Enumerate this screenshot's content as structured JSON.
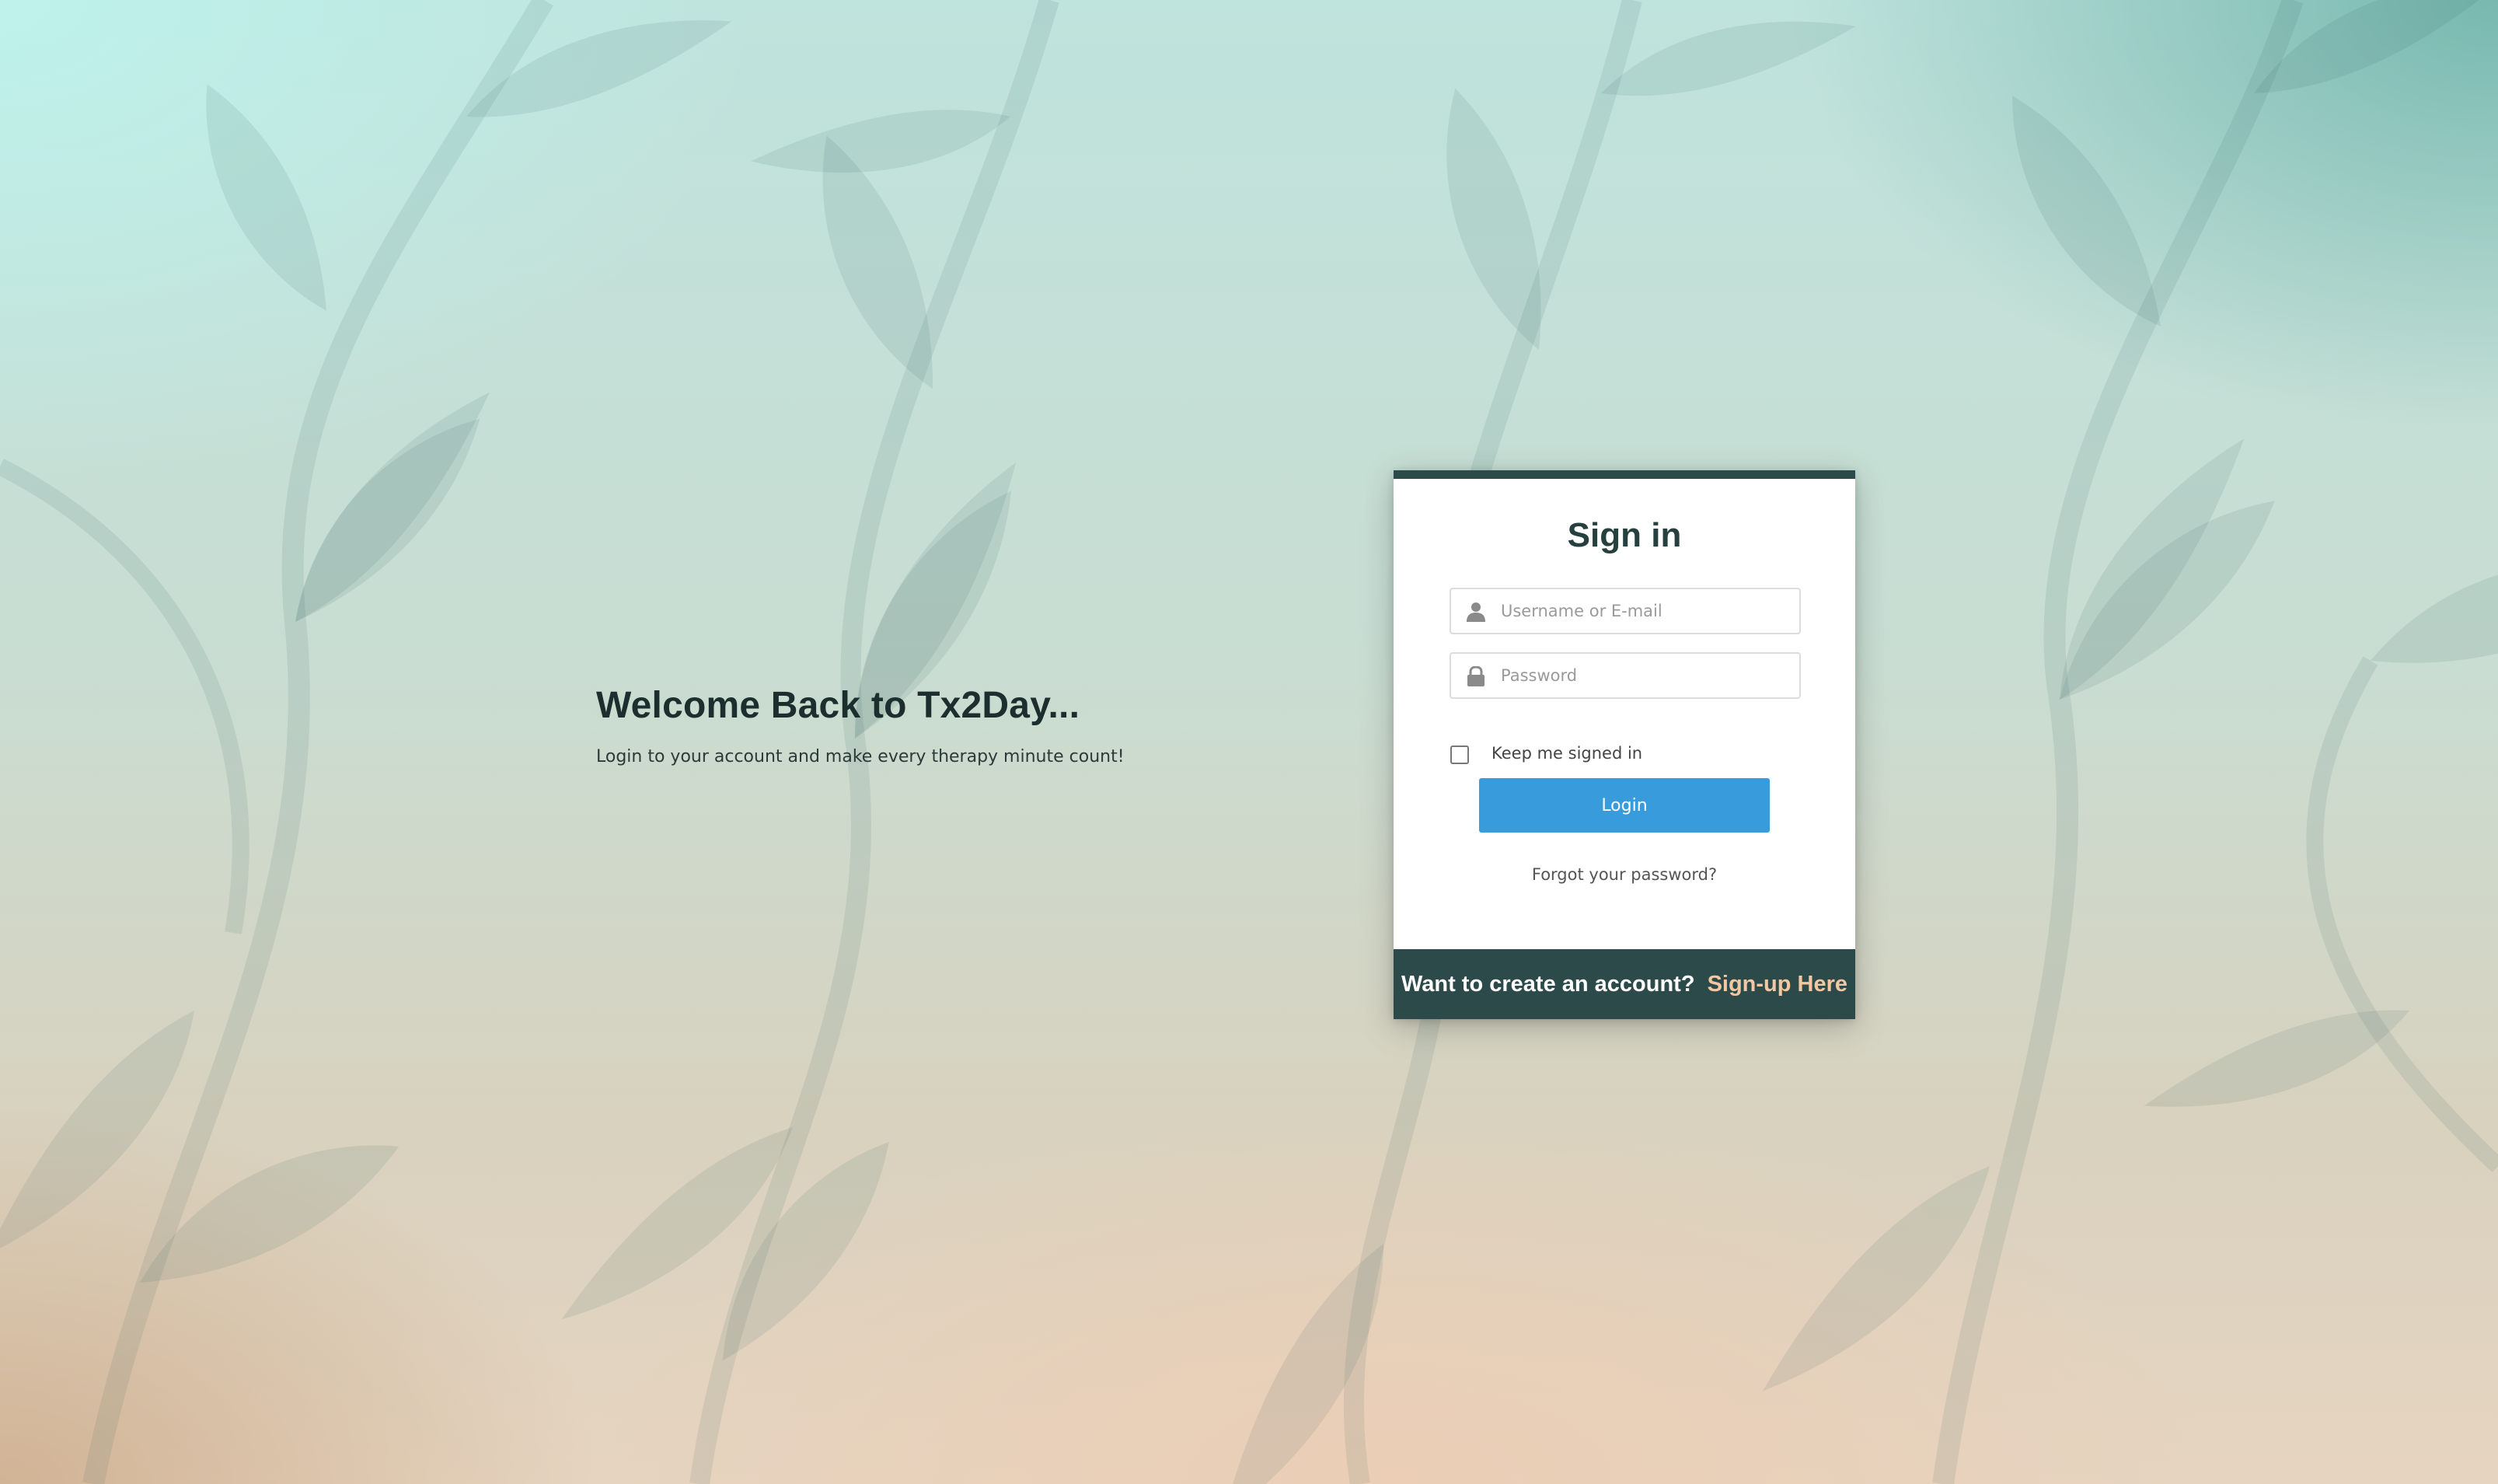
{
  "colors": {
    "accent_dark": "#2c4a4a",
    "button_blue": "#389bdc",
    "signup_link": "#f3c7a2",
    "heading": "#1c2e2d"
  },
  "welcome": {
    "title": "Welcome Back to Tx2Day...",
    "subtitle": "Login to your account and make every therapy minute count!"
  },
  "signin": {
    "title": "Sign in",
    "username": {
      "placeholder": "Username or E-mail",
      "value": "",
      "icon": "user-icon"
    },
    "password": {
      "placeholder": "Password",
      "value": "",
      "icon": "lock-icon"
    },
    "remember_label": "Keep me signed in",
    "remember_checked": false,
    "login_label": "Login",
    "forgot_label": "Forgot your password?"
  },
  "footer": {
    "prompt": "Want to create an account?",
    "signup_label": "Sign-up Here"
  }
}
